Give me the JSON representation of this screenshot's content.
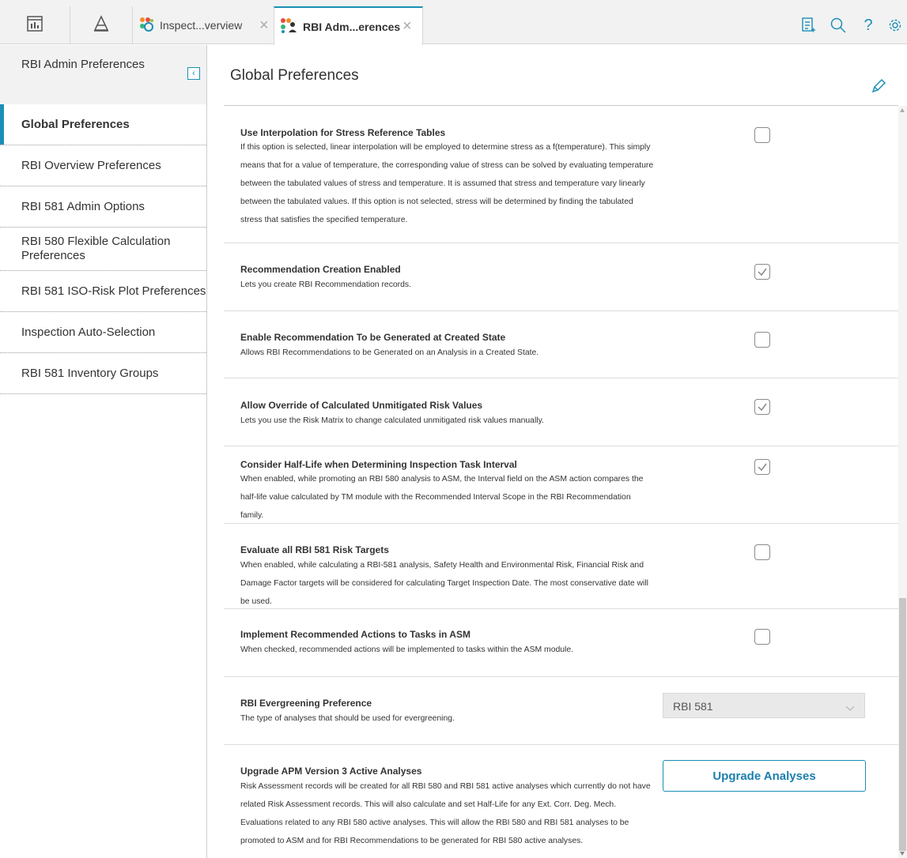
{
  "topbar": {
    "tabs": [
      {
        "label": "Inspect...verview",
        "icon": "inspection-overview-icon",
        "active": false
      },
      {
        "label": "RBI Adm...erences",
        "icon": "rbi-admin-icon",
        "active": true
      }
    ],
    "home_icon": "dashboard-icon",
    "asset_icon": "asset-hierarchy-icon",
    "right_icons": [
      "checklist-icon",
      "search-icon",
      "help-icon",
      "settings-gear-icon"
    ],
    "close_glyph": "×",
    "help_glyph": "?"
  },
  "sidebar": {
    "title": "RBI Admin Preferences",
    "collapse_glyph": "‹",
    "items": [
      {
        "label": "Global Preferences",
        "active": true
      },
      {
        "label": "RBI Overview Preferences",
        "active": false
      },
      {
        "label": "RBI 581 Admin Options",
        "active": false
      },
      {
        "label": "RBI 580 Flexible Calculation Preferences",
        "active": false
      },
      {
        "label": "RBI 581 ISO-Risk Plot Preferences",
        "active": false
      },
      {
        "label": "Inspection Auto-Selection",
        "active": false
      },
      {
        "label": "RBI 581 Inventory Groups",
        "active": false
      }
    ]
  },
  "main": {
    "title": "Global Preferences",
    "edit_icon": "pencil-edit-icon",
    "preferences": [
      {
        "title": "Use Interpolation for Stress Reference Tables",
        "description": "If this option is selected, linear interpolation will be employed to determine stress as a f(temperature). This simply means that for a value of temperature, the corresponding value of stress can be solved by evaluating temperature between the tabulated values of stress and temperature. It is assumed that stress and temperature vary linearly between the tabulated values. If this option is not selected, stress will be determined by finding the tabulated stress that satisfies the specified temperature.",
        "checked": false
      },
      {
        "title": "Recommendation Creation Enabled",
        "description": "Lets you create RBI Recommendation records.",
        "checked": true
      },
      {
        "title": "Enable Recommendation To be Generated at Created State",
        "description": "Allows RBI Recommendations to be Generated on an Analysis in a Created State.",
        "checked": false
      },
      {
        "title": "Allow Override of Calculated Unmitigated Risk Values",
        "description": "Lets you use the Risk Matrix to change calculated unmitigated risk values manually.",
        "checked": true
      },
      {
        "title": "Consider Half-Life when Determining Inspection Task Interval",
        "description": "When enabled, while promoting an RBI 580 analysis to ASM, the Interval field on the ASM action compares the half-life value calculated by TM module with the Recommended Interval Scope in the RBI Recommendation family.",
        "checked": true
      },
      {
        "title": "Evaluate all RBI 581 Risk Targets",
        "description": "When enabled, while calculating a RBI-581 analysis, Safety Health and Environmental Risk, Financial Risk and Damage Factor targets will be considered for calculating Target Inspection Date. The most conservative date will be used.",
        "checked": false
      },
      {
        "title": "Implement Recommended Actions to Tasks in ASM",
        "description": "When checked, recommended actions will be implemented to tasks within the ASM module.",
        "checked": false
      }
    ],
    "evergreening": {
      "title": "RBI Evergreening Preference",
      "description": "The type of analyses that should be used for evergreening.",
      "selected_value": "RBI 581"
    },
    "upgrade": {
      "title": "Upgrade APM Version 3 Active Analyses",
      "description": "Risk Assessment records will be created for all RBI 580 and RBI 581 active analyses which currently do not have related Risk Assessment records. This will also calculate and set Half-Life for any Ext. Corr. Deg. Mech. Evaluations related to any RBI 580 active analyses. This will allow the RBI 580 and RBI 581 analyses to be promoted to ASM and for RBI Recommendations to be generated for RBI 580 active analyses.",
      "button_label": "Upgrade Analyses"
    }
  },
  "colors": {
    "accent": "#1b8fb6",
    "tab_bar": "#f2f2f2",
    "border": "#d6d6d6"
  }
}
